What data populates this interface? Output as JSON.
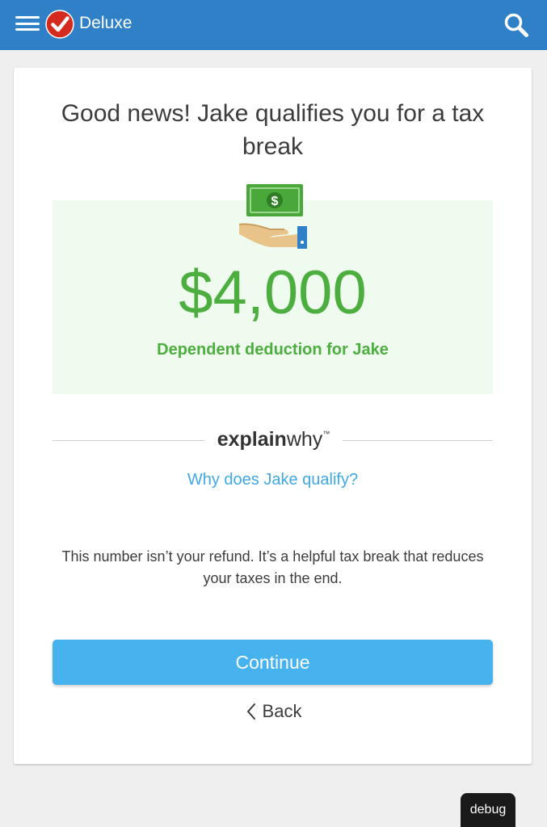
{
  "header": {
    "product_name": "Deluxe",
    "menu_icon": "hamburger-menu-icon",
    "logo_icon": "checkmark-logo-icon",
    "search_icon": "search-icon",
    "background_color": "#2f80c6"
  },
  "card": {
    "headline": "Good news! Jake qualifies you for a tax break",
    "benefit": {
      "icon": "cash-in-hand-icon",
      "amount": "$4,000",
      "label": "Dependent deduction for Jake",
      "accent_color": "#4cae3f",
      "background_color": "#f0fbef"
    },
    "explain_why": {
      "brand_strong": "explain",
      "brand_light": "why",
      "trademark": "™",
      "link_text": "Why does Jake qualify?"
    },
    "disclaimer": "This number isn’t your refund. It’s a helpful tax break that reduces your taxes in the end.",
    "continue_label": "Continue",
    "continue_color": "#46b3ef",
    "back_label": "Back"
  },
  "debug_label": "debug"
}
